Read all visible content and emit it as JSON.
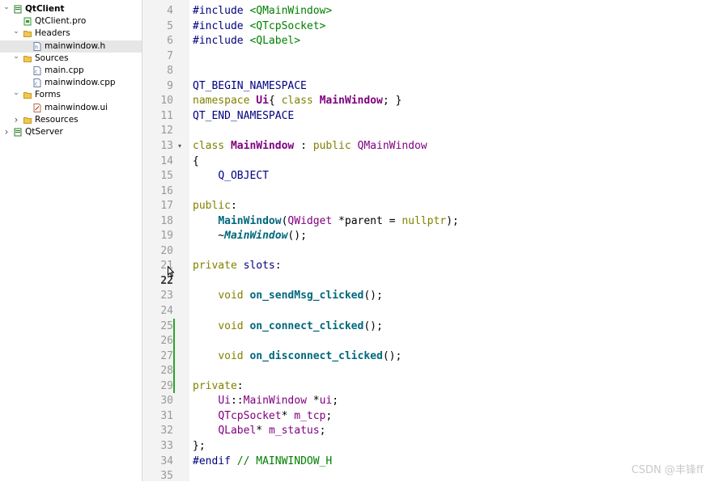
{
  "project_tree": {
    "items": [
      {
        "label": "QtClient",
        "level": 0,
        "expanded": true,
        "kind": "project",
        "bold": true
      },
      {
        "label": "QtClient.pro",
        "level": 1,
        "kind": "pro-file"
      },
      {
        "label": "Headers",
        "level": 1,
        "expanded": true,
        "kind": "folder"
      },
      {
        "label": "mainwindow.h",
        "level": 2,
        "kind": "header-file",
        "selected": true
      },
      {
        "label": "Sources",
        "level": 1,
        "expanded": true,
        "kind": "folder"
      },
      {
        "label": "main.cpp",
        "level": 2,
        "kind": "cpp-file"
      },
      {
        "label": "mainwindow.cpp",
        "level": 2,
        "kind": "cpp-file"
      },
      {
        "label": "Forms",
        "level": 1,
        "expanded": true,
        "kind": "folder"
      },
      {
        "label": "mainwindow.ui",
        "level": 2,
        "kind": "ui-file"
      },
      {
        "label": "Resources",
        "level": 1,
        "expanded": false,
        "kind": "folder"
      },
      {
        "label": "QtServer",
        "level": 0,
        "expanded": false,
        "kind": "project"
      }
    ]
  },
  "editor": {
    "current_line": "22",
    "lines": [
      {
        "n": "4",
        "tokens": [
          [
            "pp",
            "#include "
          ],
          [
            "str",
            "<QMainWindow>"
          ]
        ]
      },
      {
        "n": "5",
        "tokens": [
          [
            "pp",
            "#include "
          ],
          [
            "str",
            "<QTcpSocket>"
          ]
        ]
      },
      {
        "n": "6",
        "tokens": [
          [
            "pp",
            "#include "
          ],
          [
            "str",
            "<QLabel>"
          ]
        ]
      },
      {
        "n": "7",
        "tokens": []
      },
      {
        "n": "8",
        "tokens": []
      },
      {
        "n": "9",
        "tokens": [
          [
            "pp",
            "QT_BEGIN_NAMESPACE"
          ]
        ]
      },
      {
        "n": "10",
        "tokens": [
          [
            "kw",
            "namespace "
          ],
          [
            "tyb",
            "Ui"
          ],
          [
            "",
            "{ "
          ],
          [
            "kw",
            "class "
          ],
          [
            "tyb",
            "MainWindow"
          ],
          [
            "",
            "; }"
          ]
        ]
      },
      {
        "n": "11",
        "tokens": [
          [
            "pp",
            "QT_END_NAMESPACE"
          ]
        ]
      },
      {
        "n": "12",
        "tokens": []
      },
      {
        "n": "13",
        "tokens": [
          [
            "kw",
            "class "
          ],
          [
            "tyb",
            "MainWindow"
          ],
          [
            "",
            " : "
          ],
          [
            "kw",
            "public "
          ],
          [
            "ty",
            "QMainWindow"
          ]
        ],
        "fold": true
      },
      {
        "n": "14",
        "tokens": [
          [
            "",
            "{"
          ]
        ]
      },
      {
        "n": "15",
        "tokens": [
          [
            "",
            "    "
          ],
          [
            "pp",
            "Q_OBJECT"
          ]
        ]
      },
      {
        "n": "16",
        "tokens": []
      },
      {
        "n": "17",
        "tokens": [
          [
            "kw",
            "public"
          ],
          [
            "",
            ":"
          ]
        ]
      },
      {
        "n": "18",
        "tokens": [
          [
            "",
            "    "
          ],
          [
            "fn",
            "MainWindow"
          ],
          [
            "",
            "("
          ],
          [
            "ty",
            "QWidget"
          ],
          [
            "",
            " *parent = "
          ],
          [
            "kw",
            "nullptr"
          ],
          [
            "",
            ");"
          ]
        ]
      },
      {
        "n": "19",
        "tokens": [
          [
            "",
            "    ~"
          ],
          [
            "fni",
            "MainWindow"
          ],
          [
            "",
            "();"
          ]
        ]
      },
      {
        "n": "20",
        "tokens": []
      },
      {
        "n": "21",
        "tokens": [
          [
            "kw",
            "private "
          ],
          [
            "pp",
            "slots"
          ],
          [
            "",
            ":"
          ]
        ]
      },
      {
        "n": "22",
        "tokens": []
      },
      {
        "n": "23",
        "tokens": [
          [
            "",
            "    "
          ],
          [
            "kw",
            "void "
          ],
          [
            "fn",
            "on_sendMsg_clicked"
          ],
          [
            "",
            "();"
          ]
        ]
      },
      {
        "n": "24",
        "tokens": []
      },
      {
        "n": "25",
        "tokens": [
          [
            "",
            "    "
          ],
          [
            "kw",
            "void "
          ],
          [
            "fn",
            "on_connect_clicked"
          ],
          [
            "",
            "();"
          ]
        ]
      },
      {
        "n": "26",
        "tokens": []
      },
      {
        "n": "27",
        "tokens": [
          [
            "",
            "    "
          ],
          [
            "kw",
            "void "
          ],
          [
            "fn",
            "on_disconnect_clicked"
          ],
          [
            "",
            "();"
          ]
        ]
      },
      {
        "n": "28",
        "tokens": []
      },
      {
        "n": "29",
        "tokens": [
          [
            "kw",
            "private"
          ],
          [
            "",
            ":"
          ]
        ]
      },
      {
        "n": "30",
        "tokens": [
          [
            "",
            "    "
          ],
          [
            "ty",
            "Ui"
          ],
          [
            "",
            "::"
          ],
          [
            "ty",
            "MainWindow"
          ],
          [
            "",
            " *"
          ],
          [
            "ty",
            "ui"
          ],
          [
            "",
            ";"
          ]
        ]
      },
      {
        "n": "31",
        "tokens": [
          [
            "",
            "    "
          ],
          [
            "ty",
            "QTcpSocket"
          ],
          [
            "",
            "* "
          ],
          [
            "ty",
            "m_tcp"
          ],
          [
            "",
            ";"
          ]
        ]
      },
      {
        "n": "32",
        "tokens": [
          [
            "",
            "    "
          ],
          [
            "ty",
            "QLabel"
          ],
          [
            "",
            "* "
          ],
          [
            "ty",
            "m_status"
          ],
          [
            "",
            ";"
          ]
        ]
      },
      {
        "n": "33",
        "tokens": [
          [
            "",
            "};"
          ]
        ]
      },
      {
        "n": "34",
        "tokens": [
          [
            "pp",
            "#endif "
          ],
          [
            "cm",
            "// MAINWINDOW_H"
          ]
        ]
      },
      {
        "n": "35",
        "tokens": []
      }
    ],
    "changed_lines": [
      "25",
      "26",
      "27",
      "28",
      "29"
    ]
  },
  "watermark": "CSDN @丰锋ff"
}
